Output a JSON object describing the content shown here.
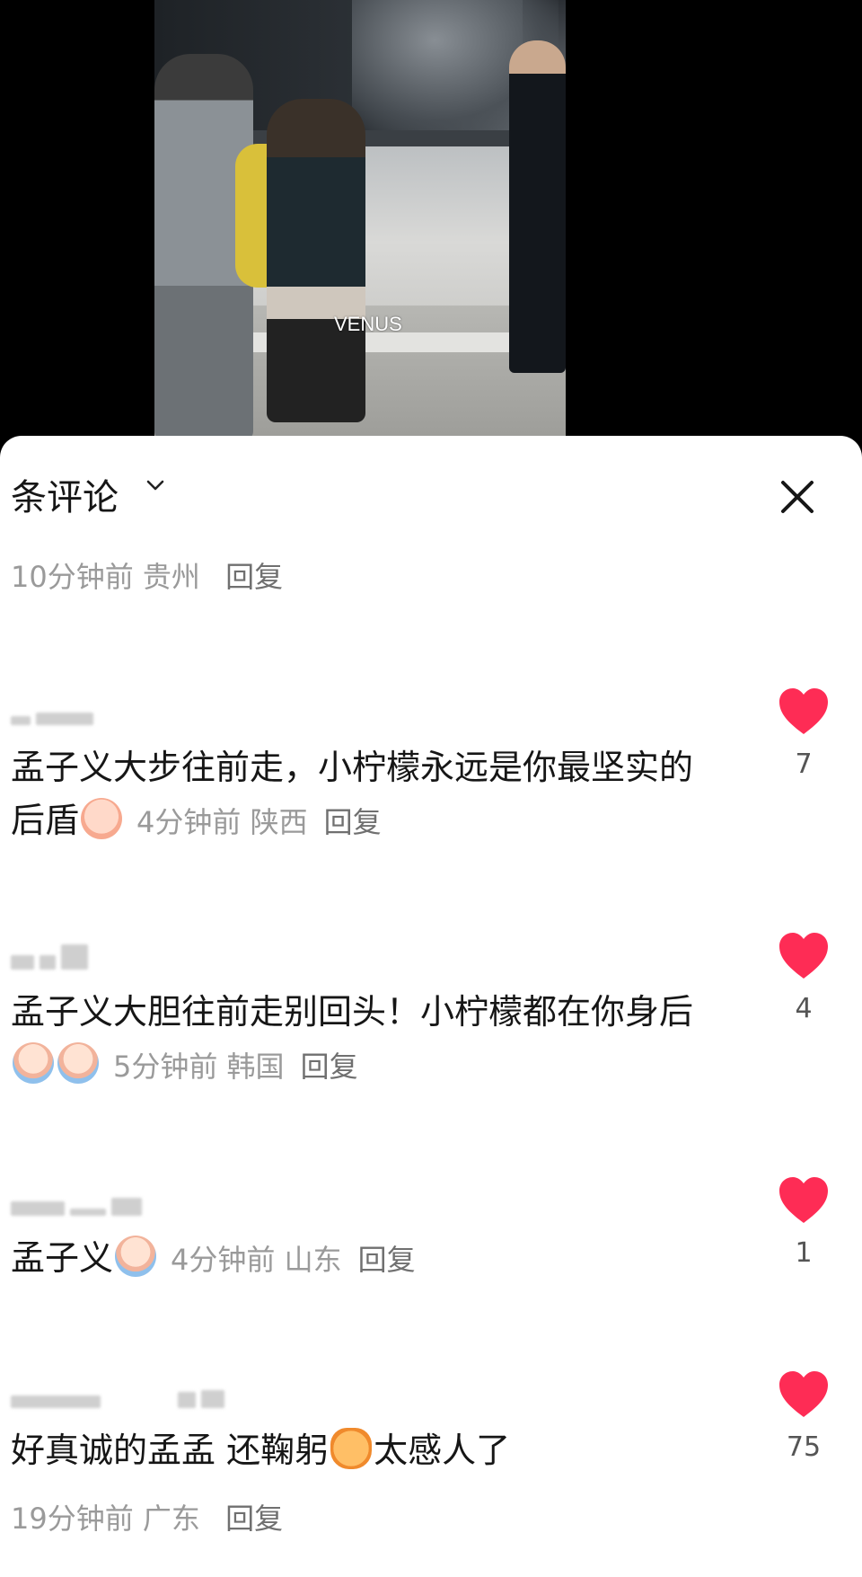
{
  "video": {
    "watermark": "VENUS"
  },
  "panel": {
    "title": "条评论",
    "chevron_icon": "chevron-down-icon",
    "close_icon": "close-icon",
    "top_meta": {
      "time": "10分钟前",
      "location": "贵州",
      "reply": "回复"
    }
  },
  "comments": [
    {
      "username": "",
      "text": "孟子义大步往前走，小柠檬永远是你最坚实的后盾",
      "emoji": [
        "blush-emoji"
      ],
      "time": "4分钟前",
      "location": "陕西",
      "reply": "回复",
      "likes": "7"
    },
    {
      "username": "",
      "text": "孟子义大胆往前走别回头！小柠檬都在你身后",
      "emoji": [
        "crying-emoji",
        "crying-emoji"
      ],
      "time": "5分钟前",
      "location": "韩国",
      "reply": "回复",
      "likes": "4"
    },
    {
      "username": "",
      "text": "孟子义",
      "emoji": [
        "crying-emoji"
      ],
      "time": "4分钟前",
      "location": "山东",
      "reply": "回复",
      "likes": "1"
    },
    {
      "username": "",
      "text": "好真诚的孟孟 还鞠躬",
      "text_after": "太感人了",
      "emoji": [
        "crying-cat-emoji"
      ],
      "time": "19分钟前",
      "location": "广东",
      "reply": "回复",
      "likes": "75"
    }
  ],
  "colors": {
    "heart": "#fe2c55",
    "text": "#161616",
    "meta": "#9a9a9a"
  }
}
